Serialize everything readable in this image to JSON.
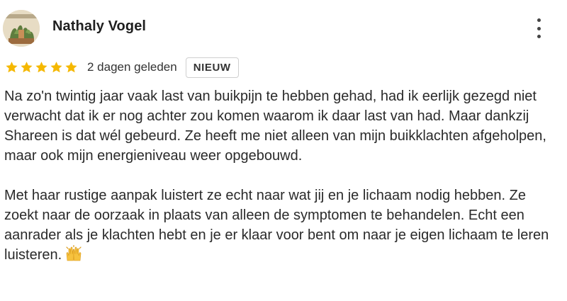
{
  "review": {
    "author": "Nathaly Vogel",
    "rating": 5,
    "rating_max": 5,
    "date": "2 dagen geleden",
    "badge": "NIEUW",
    "paragraph1": "Na zo'n twintig jaar vaak last van buikpijn te hebben gehad, had ik eerlijk gezegd niet verwacht dat ik er nog achter zou komen waarom ik daar last van had. Maar dankzij Shareen is dat wél gebeurd. Ze heeft me niet alleen van mijn buikklachten afgeholpen, maar ook mijn energieniveau weer opgebouwd.",
    "paragraph2": "Met haar rustige aanpak luistert ze echt naar wat jij en je lichaam nodig hebben. Ze zoekt naar de oorzaak in plaats van alleen de symptomen te behandelen. Echt een aanrader als je klachten hebt en je er klaar voor bent om naar je eigen lichaam te leren luisteren.",
    "emoji": "raising-hands-icon"
  },
  "colors": {
    "star": "#f5b800",
    "name": "#1f1f1f",
    "badge_border": "#cfcfcf"
  },
  "icons": {
    "avatar": "profile-photo",
    "menu": "more-vertical-icon"
  }
}
